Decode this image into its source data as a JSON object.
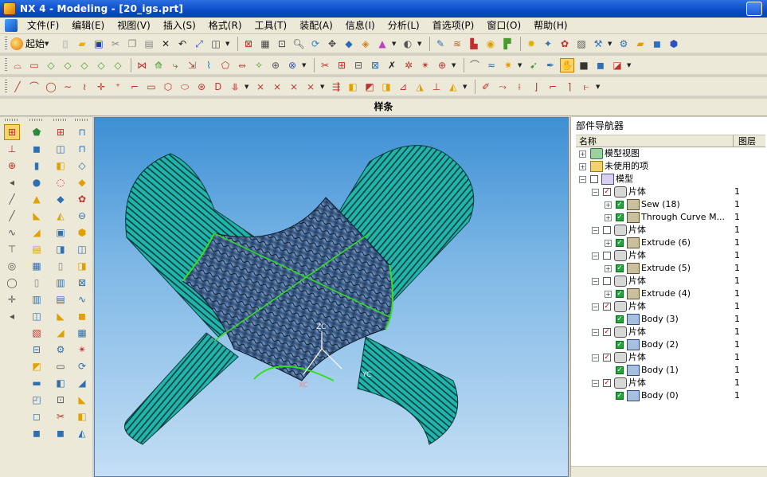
{
  "window": {
    "title": "NX 4 - Modeling - [20_igs.prt]"
  },
  "menu": [
    "文件(F)",
    "编辑(E)",
    "视图(V)",
    "插入(S)",
    "格式(R)",
    "工具(T)",
    "装配(A)",
    "信息(I)",
    "分析(L)",
    "首选项(P)",
    "窗口(O)",
    "帮助(H)"
  ],
  "toolbar": {
    "start_label": "起始"
  },
  "status": {
    "prompt": "样条"
  },
  "navigator": {
    "title": "部件导航器",
    "col_name": "名称",
    "col_layer": "图层",
    "rows": [
      {
        "label": "模型视图",
        "layer": ""
      },
      {
        "label": "未使用的项",
        "layer": ""
      },
      {
        "label": "模型",
        "layer": ""
      },
      {
        "label": "片体",
        "layer": "1"
      },
      {
        "label": "Sew (18)",
        "layer": "1"
      },
      {
        "label": "Through Curve M...",
        "layer": "1"
      },
      {
        "label": "片体",
        "layer": "1"
      },
      {
        "label": "Extrude (6)",
        "layer": "1"
      },
      {
        "label": "片体",
        "layer": "1"
      },
      {
        "label": "Extrude (5)",
        "layer": "1"
      },
      {
        "label": "片体",
        "layer": "1"
      },
      {
        "label": "Extrude (4)",
        "layer": "1"
      },
      {
        "label": "片体",
        "layer": "1"
      },
      {
        "label": "Body (3)",
        "layer": "1"
      },
      {
        "label": "片体",
        "layer": "1"
      },
      {
        "label": "Body (2)",
        "layer": "1"
      },
      {
        "label": "片体",
        "layer": "1"
      },
      {
        "label": "Body (1)",
        "layer": "1"
      },
      {
        "label": "片体",
        "layer": "1"
      },
      {
        "label": "Body (0)",
        "layer": "1"
      }
    ]
  },
  "viewport": {
    "axis_zc": "ZC",
    "axis_yc": "YC",
    "axis_xc": "XC"
  },
  "colors": {
    "surface_teal": "#1fb5ad",
    "center_surface": "#4a6d9a",
    "edge_green": "#32e020",
    "viewport_top": "#3d8fd4"
  }
}
